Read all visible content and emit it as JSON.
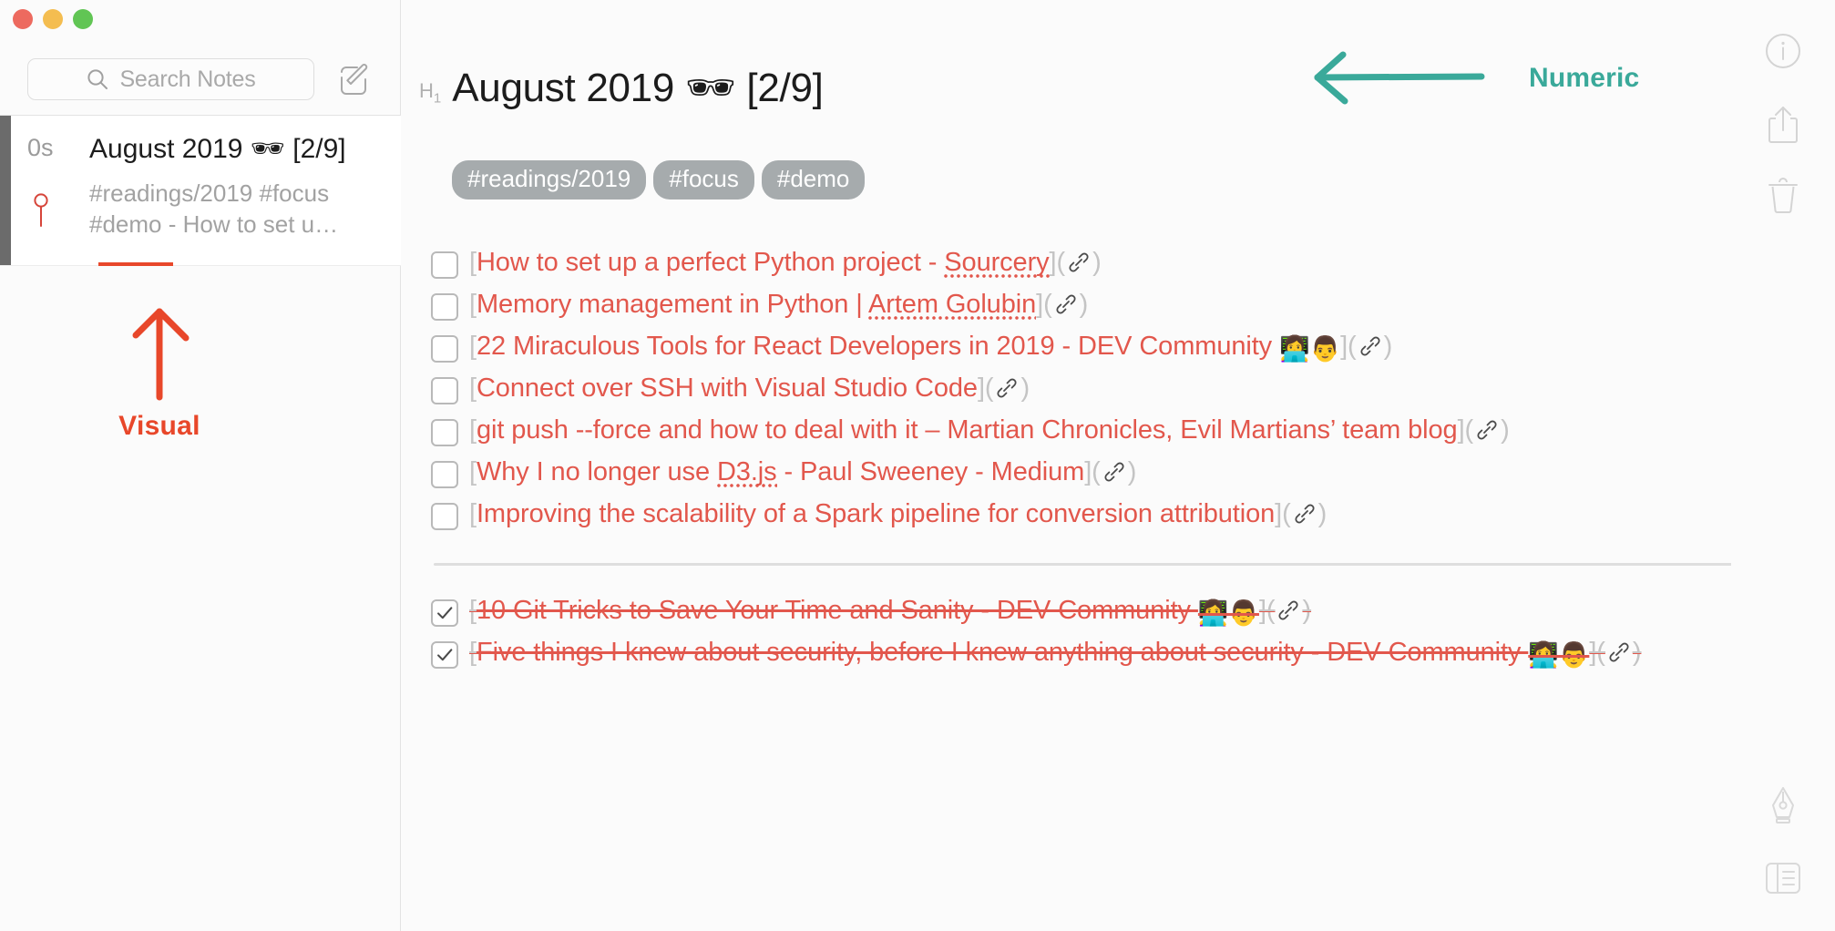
{
  "window": {
    "traffic_lights": [
      "close",
      "minimize",
      "maximize"
    ],
    "colors": {
      "close": "#ed6a5f",
      "minimize": "#f4bd50",
      "maximize": "#61c554",
      "accent_red": "#e2574c",
      "annotation_visual": "#e8472a",
      "annotation_numeric": "#3aa99a",
      "tag_pill": "#a6abad"
    }
  },
  "sidebar": {
    "search": {
      "placeholder": "Search Notes",
      "icon": "search-icon"
    },
    "compose_icon": "compose-note-icon",
    "notes": [
      {
        "age": "0s",
        "pinned": true,
        "pin_icon": "pin-icon",
        "title": "August 2019 🕶 [2/9]",
        "preview": "#readings/2019 #focus #demo - How to set u…",
        "selected": true
      }
    ]
  },
  "annotations": {
    "visual": {
      "label": "Visual",
      "arrow": "arrow-up-icon",
      "color": "#e8472a"
    },
    "numeric": {
      "label": "Numeric",
      "arrow": "arrow-left-icon",
      "color": "#3aa99a"
    }
  },
  "editor": {
    "heading_marker": "H",
    "heading_marker_level": "1",
    "title": "August 2019 🕶 [2/9]",
    "tags": [
      "#readings/2019",
      "#focus",
      "#demo"
    ],
    "todos": [
      {
        "checked": false,
        "open_bracket": "[",
        "text_before": "How to set up a perfect Python project - ",
        "misspelled": "Sourcery",
        "text_after": "",
        "emoji": "",
        "close_bracket": "](",
        "link_icon": "link-icon",
        "end_paren": ")"
      },
      {
        "checked": false,
        "open_bracket": "[",
        "text_before": "Memory management in Python | ",
        "misspelled": "Artem Golubin",
        "text_after": "",
        "emoji": "",
        "close_bracket": "](",
        "link_icon": "link-icon",
        "end_paren": ")"
      },
      {
        "checked": false,
        "open_bracket": "[",
        "text_before": "22 Miraculous Tools for React Developers in 2019 - DEV Community ",
        "misspelled": "",
        "text_after": "",
        "emoji": "👩‍💻👨",
        "close_bracket": "](",
        "link_icon": "link-icon",
        "end_paren": ")"
      },
      {
        "checked": false,
        "open_bracket": "[",
        "text_before": "Connect over SSH with Visual Studio Code",
        "misspelled": "",
        "text_after": "",
        "emoji": "",
        "close_bracket": "](",
        "link_icon": "link-icon",
        "end_paren": ")"
      },
      {
        "checked": false,
        "open_bracket": "[",
        "text_before": "git push --force and how to deal with it – Martian Chronicles, Evil Martians’ team blog",
        "misspelled": "",
        "text_after": "",
        "emoji": "",
        "close_bracket": "](",
        "link_icon": "link-icon",
        "end_paren": ")"
      },
      {
        "checked": false,
        "open_bracket": "[",
        "text_before": "Why I no longer use ",
        "misspelled": "D3.js",
        "text_after": " - Paul Sweeney - Medium",
        "emoji": "",
        "close_bracket": "](",
        "link_icon": "link-icon",
        "end_paren": ")"
      },
      {
        "checked": false,
        "open_bracket": "[",
        "text_before": "Improving the scalability of a Spark pipeline for conversion attribution",
        "misspelled": "",
        "text_after": "",
        "emoji": "",
        "close_bracket": "](",
        "link_icon": "link-icon",
        "end_paren": ")"
      }
    ],
    "todos_done": [
      {
        "checked": true,
        "open_bracket": "[",
        "text_before": "10 Git Tricks to Save Your Time and Sanity - DEV Community ",
        "misspelled": "",
        "text_after": "",
        "emoji": "👩‍💻👨",
        "close_bracket": "](",
        "link_icon": "link-icon",
        "end_paren": ")"
      },
      {
        "checked": true,
        "open_bracket": "[",
        "text_before": "Five things I knew about security, before I knew anything about security - DEV Community ",
        "misspelled": "",
        "text_after": "",
        "emoji": "👩‍💻👨",
        "close_bracket": "](",
        "link_icon": "link-icon",
        "end_paren": ")"
      }
    ]
  },
  "right_rail": {
    "buttons": [
      {
        "icon": "info-icon",
        "name": "info-button"
      },
      {
        "icon": "share-icon",
        "name": "share-button"
      },
      {
        "icon": "trash-icon",
        "name": "delete-button"
      },
      {
        "icon": "pen-nib-icon",
        "name": "markdown-pen-button"
      },
      {
        "icon": "book-layout-icon",
        "name": "preview-layout-button"
      }
    ]
  }
}
